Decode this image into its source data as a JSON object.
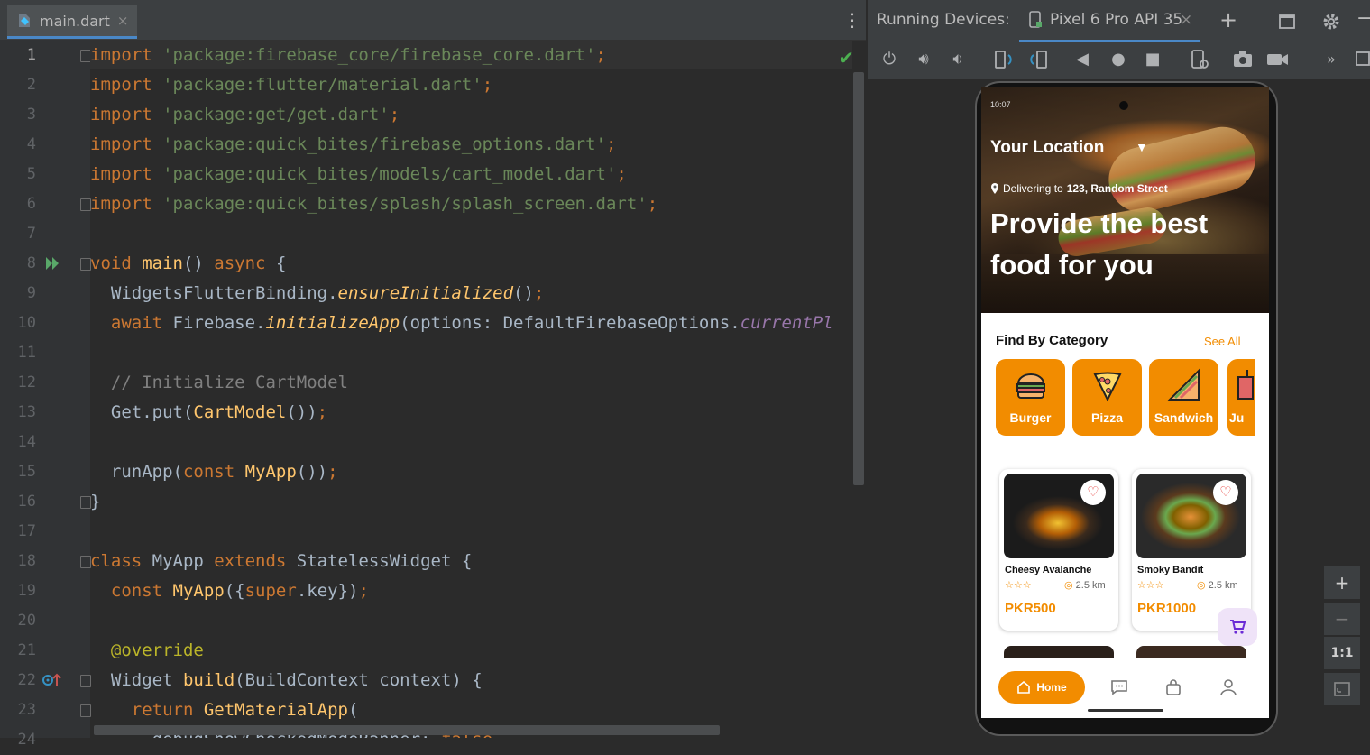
{
  "editor": {
    "tab_label": "main.dart",
    "tab_close": "×",
    "kebab": "⋮",
    "lines": [
      {
        "n": "1",
        "parts": [
          [
            "kw",
            "import "
          ],
          [
            "str",
            "'package:firebase_core/firebase_core.dart'"
          ],
          [
            "kw",
            ";"
          ]
        ]
      },
      {
        "n": "2",
        "parts": [
          [
            "kw",
            "import "
          ],
          [
            "str",
            "'package:flutter/material.dart'"
          ],
          [
            "kw",
            ";"
          ]
        ]
      },
      {
        "n": "3",
        "parts": [
          [
            "kw",
            "import "
          ],
          [
            "str",
            "'package:get/get.dart'"
          ],
          [
            "kw",
            ";"
          ]
        ]
      },
      {
        "n": "4",
        "parts": [
          [
            "kw",
            "import "
          ],
          [
            "str",
            "'package:quick_bites/firebase_options.dart'"
          ],
          [
            "kw",
            ";"
          ]
        ]
      },
      {
        "n": "5",
        "parts": [
          [
            "kw",
            "import "
          ],
          [
            "str",
            "'package:quick_bites/models/cart_model.dart'"
          ],
          [
            "kw",
            ";"
          ]
        ]
      },
      {
        "n": "6",
        "parts": [
          [
            "kw",
            "import "
          ],
          [
            "str",
            "'package:quick_bites/splash/splash_screen.dart'"
          ],
          [
            "kw",
            ";"
          ]
        ]
      },
      {
        "n": "7",
        "parts": []
      },
      {
        "n": "8",
        "parts": [
          [
            "kw",
            "void "
          ],
          [
            "fn",
            "main"
          ],
          [
            "cls",
            "() "
          ],
          [
            "kw",
            "async "
          ],
          [
            "cls",
            "{"
          ]
        ]
      },
      {
        "n": "9",
        "parts": [
          [
            "cls",
            "  WidgetsFlutterBinding."
          ],
          [
            "it",
            "ensureInitialized"
          ],
          [
            "cls",
            "()"
          ],
          [
            "kw",
            ";"
          ]
        ]
      },
      {
        "n": "10",
        "parts": [
          [
            "kw",
            "  await "
          ],
          [
            "cls",
            "Firebase."
          ],
          [
            "it",
            "initializeApp"
          ],
          [
            "cls",
            "(options: DefaultFirebaseOptions."
          ],
          [
            "prop",
            "currentPl"
          ]
        ]
      },
      {
        "n": "11",
        "parts": []
      },
      {
        "n": "12",
        "parts": [
          [
            "cm",
            "  // Initialize CartModel"
          ]
        ]
      },
      {
        "n": "13",
        "parts": [
          [
            "cls",
            "  Get.put("
          ],
          [
            "fn",
            "CartModel"
          ],
          [
            "cls",
            "())"
          ],
          [
            "kw",
            ";"
          ]
        ]
      },
      {
        "n": "14",
        "parts": []
      },
      {
        "n": "15",
        "parts": [
          [
            "cls",
            "  runApp("
          ],
          [
            "kw",
            "const "
          ],
          [
            "fn",
            "MyApp"
          ],
          [
            "cls",
            "())"
          ],
          [
            "kw",
            ";"
          ]
        ]
      },
      {
        "n": "16",
        "parts": [
          [
            "cls",
            "}"
          ]
        ]
      },
      {
        "n": "17",
        "parts": []
      },
      {
        "n": "18",
        "parts": [
          [
            "kw",
            "class "
          ],
          [
            "cls",
            "MyApp "
          ],
          [
            "kw",
            "extends "
          ],
          [
            "cls",
            "StatelessWidget {"
          ]
        ]
      },
      {
        "n": "19",
        "parts": [
          [
            "kw",
            "  const "
          ],
          [
            "fn",
            "MyApp"
          ],
          [
            "cls",
            "({"
          ],
          [
            "kw",
            "super"
          ],
          [
            "cls",
            ".key})"
          ],
          [
            "kw",
            ";"
          ]
        ]
      },
      {
        "n": "20",
        "parts": []
      },
      {
        "n": "21",
        "parts": [
          [
            "ann",
            "  @override"
          ]
        ]
      },
      {
        "n": "22",
        "parts": [
          [
            "cls",
            "  Widget "
          ],
          [
            "fn",
            "build"
          ],
          [
            "cls",
            "(BuildContext context) {"
          ]
        ]
      },
      {
        "n": "23",
        "parts": [
          [
            "kw",
            "    return "
          ],
          [
            "fn",
            "GetMaterialApp"
          ],
          [
            "cls",
            "("
          ]
        ]
      },
      {
        "n": "24",
        "parts": [
          [
            "cls",
            "      debugShowCheckedModeBanner: "
          ],
          [
            "kw",
            "false"
          ],
          [
            "kw",
            ","
          ]
        ]
      }
    ]
  },
  "devices": {
    "header_label": "Running Devices:",
    "device_tab": "Pixel 6 Pro API 35",
    "tab_close": "×",
    "add": "+",
    "zoom_in": "+",
    "zoom_out": "−",
    "zoom_reset": "1:1"
  },
  "app": {
    "status_time": "10:07",
    "location_title": "Your Location",
    "deliver_prefix": "Delivering to ",
    "deliver_address": "123, Random Street",
    "headline": "Provide the best food for you",
    "category_title": "Find By Category",
    "see_all": "See All",
    "categories": [
      "Burger",
      "Pizza",
      "Sandwich",
      "Ju"
    ],
    "products": [
      {
        "name": "Cheesy Avalanche",
        "distance": "2.5 km",
        "price": "PKR500"
      },
      {
        "name": "Smoky Bandit",
        "distance": "2.5 km",
        "price": "PKR1000"
      }
    ],
    "nav_home": "Home",
    "accent": "#F28C00"
  }
}
